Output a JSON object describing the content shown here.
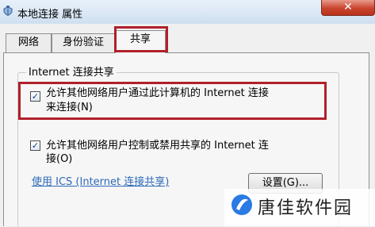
{
  "window": {
    "title": "本地连接 属性",
    "close_label": "✕",
    "icon": "network-connection-icon"
  },
  "tabs": [
    {
      "label": "网络",
      "active": false
    },
    {
      "label": "身份验证",
      "active": false
    },
    {
      "label": "共享",
      "active": true
    }
  ],
  "sharing": {
    "group_title": "Internet 连接共享",
    "option1": {
      "line1": "允许其他网络用户通过此计算机的 Internet 连接",
      "line2": "来连接(N)",
      "checked": true,
      "check_mark": "✓"
    },
    "option2": {
      "line1": "允许其他网络用户控制或禁用共享的 Internet 连",
      "line2": "接(O)",
      "checked": true,
      "check_mark": "✓"
    },
    "ics_link": "使用 ICS (Internet 连接共享)",
    "settings_button": "设置(G)..."
  },
  "watermark": {
    "text": "唐佳软件园",
    "color": "#2a7be4"
  },
  "colors": {
    "highlight_border": "#b0202a",
    "link": "#2c69b8"
  }
}
